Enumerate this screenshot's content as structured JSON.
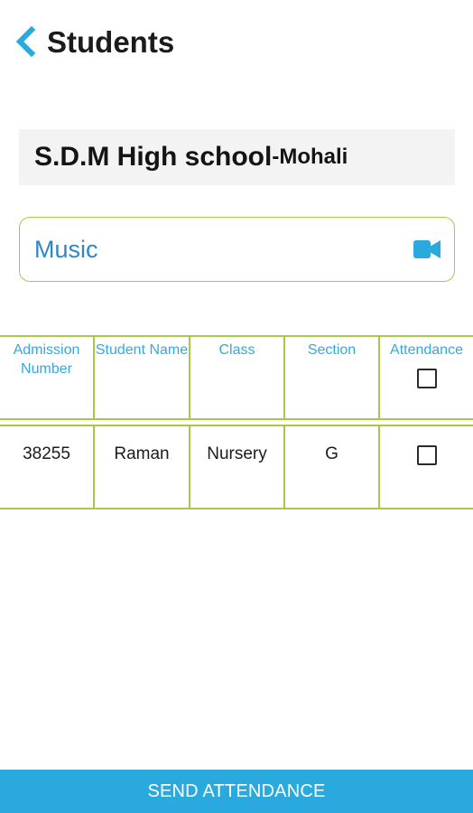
{
  "header": {
    "title": "Students",
    "back_icon": "chevron-left-icon"
  },
  "school": {
    "name": "S.D.M High school",
    "city": "-Mohali"
  },
  "subject": {
    "label": "Music",
    "icon": "video-camera-icon"
  },
  "table": {
    "columns": [
      "Admission Number",
      "Student Name",
      "Class",
      "Section",
      "Attendance"
    ],
    "rows": [
      {
        "admission_number": "38255",
        "name": "Raman",
        "class": "Nursery",
        "section": "G",
        "attendance": false
      }
    ],
    "select_all": false
  },
  "footer": {
    "send_label": "SEND ATTENDANCE"
  },
  "colors": {
    "accent": "#2aa9df",
    "title_blue": "#2f86c8",
    "border_green": "#a8c84a"
  }
}
